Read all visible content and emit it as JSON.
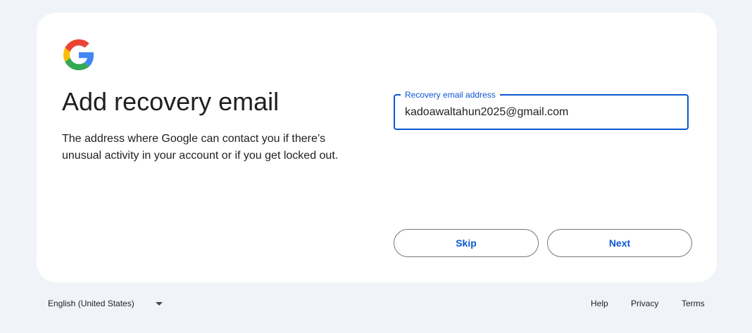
{
  "logo": {
    "icon": "google-g-icon",
    "colors": [
      "#4285F4",
      "#EA4335",
      "#FBBC05",
      "#34A853"
    ]
  },
  "page": {
    "title": "Add recovery email",
    "description": "The address where Google can contact you if there’s unusual activity in your account or if you get locked out."
  },
  "form": {
    "label": "Recovery email address",
    "value": "kadoawaltahun2025@gmail.com"
  },
  "actions": {
    "skip_label": "Skip",
    "next_label": "Next"
  },
  "footer": {
    "language": "English (United States)",
    "help": "Help",
    "privacy": "Privacy",
    "terms": "Terms"
  },
  "colors": {
    "background": "#f0f4f9",
    "card": "#ffffff",
    "accent": "#0b57d0",
    "text": "#1f1f1f",
    "outline": "#747775"
  }
}
